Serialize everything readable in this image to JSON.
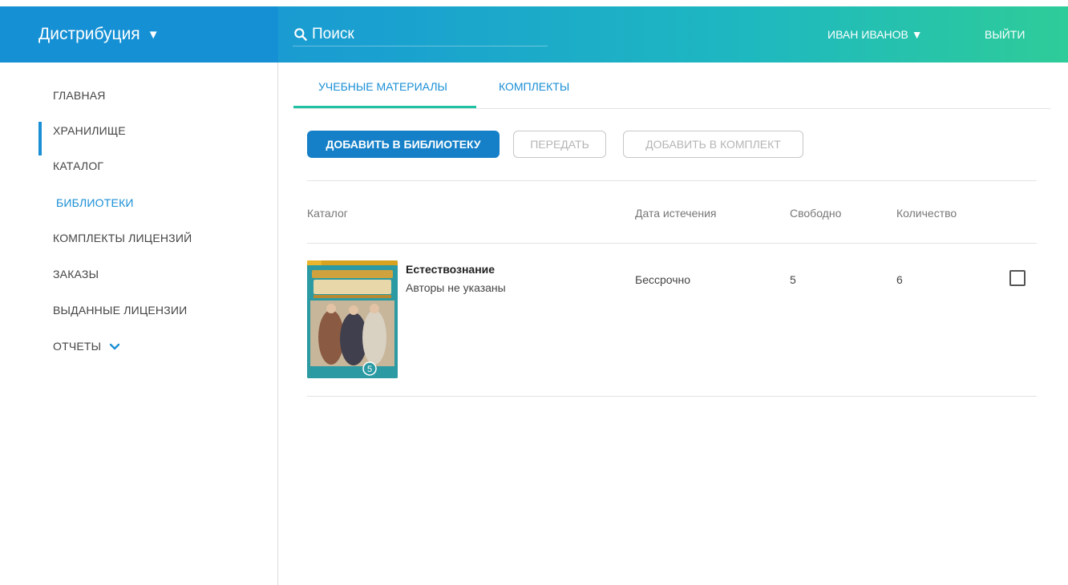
{
  "header": {
    "brand": "Дистрибуция",
    "brand_caret": "▼",
    "search_placeholder": "Поиск",
    "user": "ИВАН ИВАНОВ ▼",
    "logout": "ВЫЙТИ"
  },
  "sidebar": {
    "items": [
      {
        "label": "ГЛАВНАЯ"
      },
      {
        "label": "ХРАНИЛИЩЕ"
      },
      {
        "label": "КАТАЛОГ"
      },
      {
        "label": "БИБЛИОТЕКИ",
        "active": true
      },
      {
        "label": "КОМПЛЕКТЫ ЛИЦЕНЗИЙ"
      },
      {
        "label": "ЗАКАЗЫ"
      },
      {
        "label": "ВЫДАННЫЕ ЛИЦЕНЗИИ"
      },
      {
        "label": "ОТЧЕТЫ",
        "expandable": true
      }
    ]
  },
  "tabs": [
    {
      "label": "УЧЕБНЫЕ МАТЕРИАЛЫ",
      "active": true
    },
    {
      "label": "КОМПЛЕКТЫ"
    }
  ],
  "toolbar": {
    "add_to_library": "ДОБАВИТЬ В БИБЛИОТЕКУ",
    "transfer": "ПЕРЕДАТЬ",
    "add_to_set": "ДОБАВИТЬ В КОМПЛЕКТ"
  },
  "table": {
    "columns": [
      "Каталог",
      "Дата истечения",
      "Свободно",
      "Количество"
    ],
    "rows": [
      {
        "title": "Естествознание",
        "authors": "Авторы не указаны",
        "expiry": "Бессрочно",
        "free": "5",
        "quantity": "6",
        "checked": false,
        "cover_grade": "5"
      }
    ]
  },
  "colors": {
    "accent": "#1a8fd6",
    "tab_underline": "#21c2a4",
    "primary_button": "#1580c8"
  }
}
